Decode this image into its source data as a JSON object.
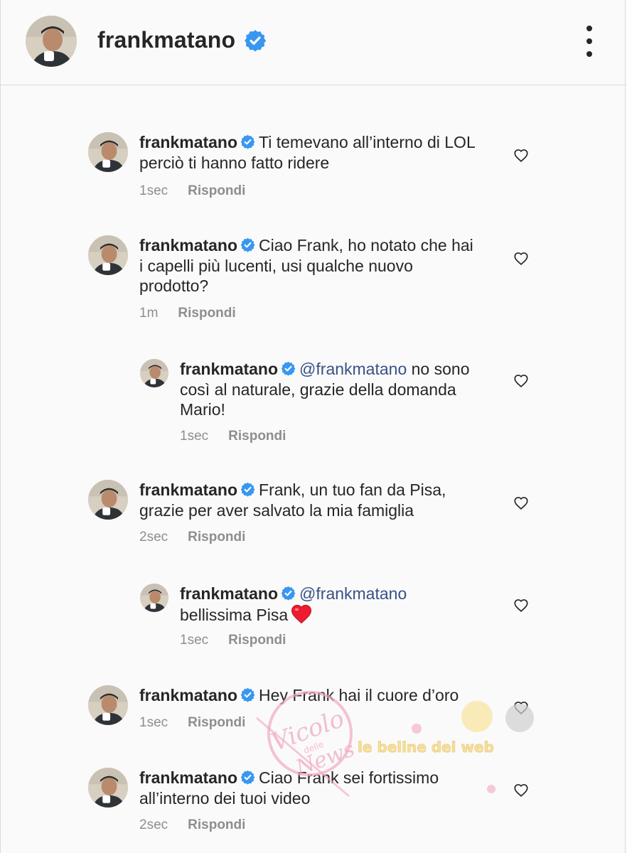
{
  "header": {
    "username": "frankmatano"
  },
  "comments": [
    {
      "username": "frankmatano",
      "text": "Ti temevano all’interno di LOL perciò ti hanno fatto ridere",
      "time": "1sec",
      "reply_label": "Rispondi"
    },
    {
      "username": "frankmatano",
      "text": "Ciao Frank, ho notato che hai i capelli più lucenti, usi qualche nuovo prodotto?",
      "time": "1m",
      "reply_label": "Rispondi"
    },
    {
      "username": "frankmatano",
      "mention": "@frankmatano",
      "text": "no sono così al naturale, grazie della domanda Mario!",
      "time": "1sec",
      "reply_label": "Rispondi"
    },
    {
      "username": "frankmatano",
      "text": "Frank, un tuo fan da Pisa, grazie per aver salvato la mia famiglia",
      "time": "2sec",
      "reply_label": "Rispondi"
    },
    {
      "username": "frankmatano",
      "mention": "@frankmatano",
      "text": "bellissima Pisa",
      "emoji": "red-heart-emoji",
      "time": "1sec",
      "reply_label": "Rispondi"
    },
    {
      "username": "frankmatano",
      "text": "Hey Frank hai il cuore d’oro",
      "time": "1sec",
      "reply_label": "Rispondi"
    },
    {
      "username": "frankmatano",
      "text": "Ciao Frank sei fortissimo all’interno dei tuoi video",
      "time": "2sec",
      "reply_label": "Rispondi"
    }
  ],
  "watermark": {
    "line1": "Vicolo",
    "line2": "delle",
    "line3": "News",
    "text": "le beline dei web"
  },
  "colors": {
    "verified": "#3897f0",
    "text": "#262626",
    "secondary": "#8e8e8e",
    "mention": "#385185",
    "emoji_heart": "#ed1c2e"
  },
  "icons": {
    "more": "more-vertical-icon",
    "verified": "verified-badge-icon",
    "like": "heart-outline-icon"
  }
}
